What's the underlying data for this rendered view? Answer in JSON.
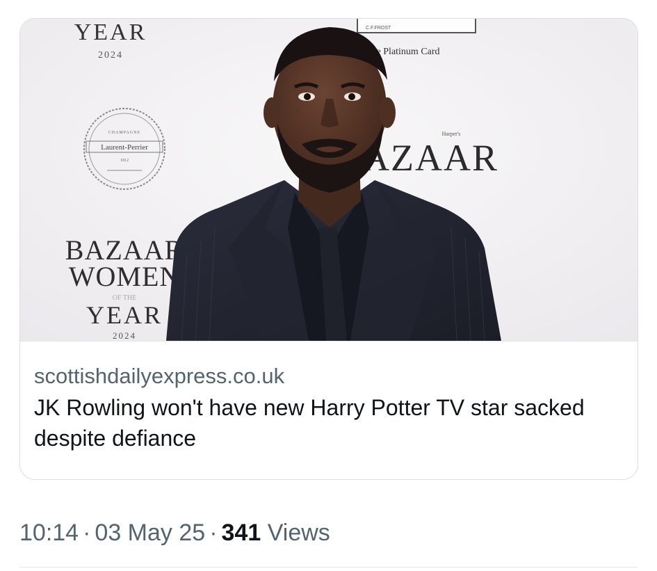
{
  "card": {
    "image_alt": "Man with beard in dark suit at Harper's Bazaar Women of the Year 2024 event",
    "backdrop": {
      "year_top": "YEAR",
      "year_top_num": "2024",
      "seal_line1": "CHAMPAGNE",
      "seal_brand": "Laurent-Perrier",
      "seal_year": "1812",
      "bazaar_right": "AZAAR",
      "harpers_small": "Harper's",
      "platinum": "The Platinum Card",
      "frost": "C.F.FROST",
      "bazaar_left": "BAZAAR",
      "women": "WOMEN",
      "of": "OF THE",
      "year_bottom": "YEAR",
      "year_bottom_num": "2024"
    },
    "domain": "scottishdailyexpress.co.uk",
    "headline": "JK Rowling won't have new Harry Potter TV star sacked despite defiance"
  },
  "post_meta": {
    "time": "10:14",
    "separator": "·",
    "date": "03 May 25",
    "views_count": "341",
    "views_label": "Views"
  },
  "colors": {
    "secondary_text": "#536471",
    "primary_text": "#0f1419",
    "border": "#d9dee2"
  }
}
